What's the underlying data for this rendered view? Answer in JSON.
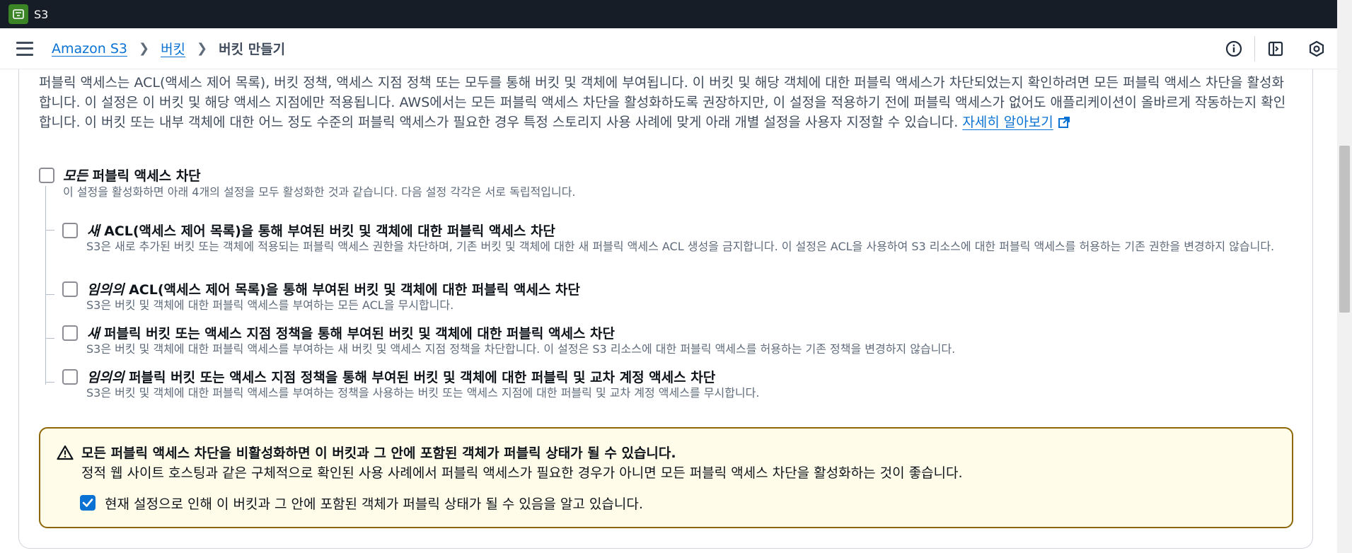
{
  "app": {
    "service_name": "S3",
    "service_icon": "bucket-icon",
    "brand_color": "#3b8526"
  },
  "breadcrumb": {
    "root": "Amazon S3",
    "parent": "버킷",
    "current": "버킷 만들기"
  },
  "nav_icons": [
    "info-icon",
    "panel-icon",
    "settings-hex-icon"
  ],
  "intro": {
    "text": "퍼블릭 액세스는 ACL(액세스 제어 목록), 버킷 정책, 액세스 지점 정책 또는 모두를 통해 버킷 및 객체에 부여됩니다. 이 버킷 및 해당 객체에 대한 퍼블릭 액세스가 차단되었는지 확인하려면 모든 퍼블릭 액세스 차단을 활성화합니다. 이 설정은 이 버킷 및 해당 액세스 지점에만 적용됩니다. AWS에서는 모든 퍼블릭 액세스 차단을 활성화하도록 권장하지만, 이 설정을 적용하기 전에 퍼블릭 액세스가 없어도 애플리케이션이 올바르게 작동하는지 확인합니다. 이 버킷 또는 내부 객체에 대한 어느 정도 수준의 퍼블릭 액세스가 필요한 경우 특정 스토리지 사용 사례에 맞게 아래 개별 설정을 사용자 지정할 수 있습니다. ",
    "link": "자세히 알아보기"
  },
  "block_all": {
    "title_em": "모든",
    "title_rest": " 퍼블릭 액세스 차단",
    "desc": "이 설정을 활성화하면 아래 4개의 설정을 모두 활성화한 것과 같습니다. 다음 설정 각각은 서로 독립적입니다.",
    "checked": false
  },
  "options": [
    {
      "title_em": "새",
      "title_rest": " ACL(액세스 제어 목록)을 통해 부여된 버킷 및 객체에 대한 퍼블릭 액세스 차단",
      "desc": "S3은 새로 추가된 버킷 또는 객체에 적용되는 퍼블릭 액세스 권한을 차단하며, 기존 버킷 및 객체에 대한 새 퍼블릭 액세스 ACL 생성을 금지합니다. 이 설정은 ACL을 사용하여 S3 리소스에 대한 퍼블릭 액세스를 허용하는 기존 권한을 변경하지 않습니다.",
      "checked": false
    },
    {
      "title_em": "임의의",
      "title_rest": " ACL(액세스 제어 목록)을 통해 부여된 버킷 및 객체에 대한 퍼블릭 액세스 차단",
      "desc": "S3은 버킷 및 객체에 대한 퍼블릭 액세스를 부여하는 모든 ACL을 무시합니다.",
      "checked": false
    },
    {
      "title_em": "새",
      "title_rest": " 퍼블릭 버킷 또는 액세스 지점 정책을 통해 부여된 버킷 및 객체에 대한 퍼블릭 액세스 차단",
      "desc": "S3은 버킷 및 객체에 대한 퍼블릭 액세스를 부여하는 새 버킷 및 액세스 지점 정책을 차단합니다. 이 설정은 S3 리소스에 대한 퍼블릭 액세스를 허용하는 기존 정책을 변경하지 않습니다.",
      "checked": false
    },
    {
      "title_em": "임의의",
      "title_rest": " 퍼블릭 버킷 또는 액세스 지점 정책을 통해 부여된 버킷 및 객체에 대한 퍼블릭 및 교차 계정 액세스 차단",
      "desc": "S3은 버킷 및 객체에 대한 퍼블릭 액세스를 부여하는 정책을 사용하는 버킷 또는 액세스 지점에 대한 퍼블릭 및 교차 계정 액세스를 무시합니다.",
      "checked": false
    }
  ],
  "warning": {
    "icon": "warning-triangle-icon",
    "title": "모든 퍼블릭 액세스 차단을 비활성화하면 이 버킷과 그 안에 포함된 객체가 퍼블릭 상태가 될 수 있습니다.",
    "body": "정적 웹 사이트 호스팅과 같은 구체적으로 확인된 사용 사례에서 퍼블릭 액세스가 필요한 경우가 아니면 모든 퍼블릭 액세스 차단을 활성화하는 것이 좋습니다.",
    "ack": "현재 설정으로 인해 이 버킷과 그 안에 포함된 객체가 퍼블릭 상태가 될 수 있음을 알고 있습니다.",
    "ack_checked": true,
    "border_color": "#8d6605",
    "bg_color": "#fffce9"
  },
  "colors": {
    "link": "#0972d3",
    "checkbox_checked": "#0972d3",
    "topbar": "#161d26"
  }
}
